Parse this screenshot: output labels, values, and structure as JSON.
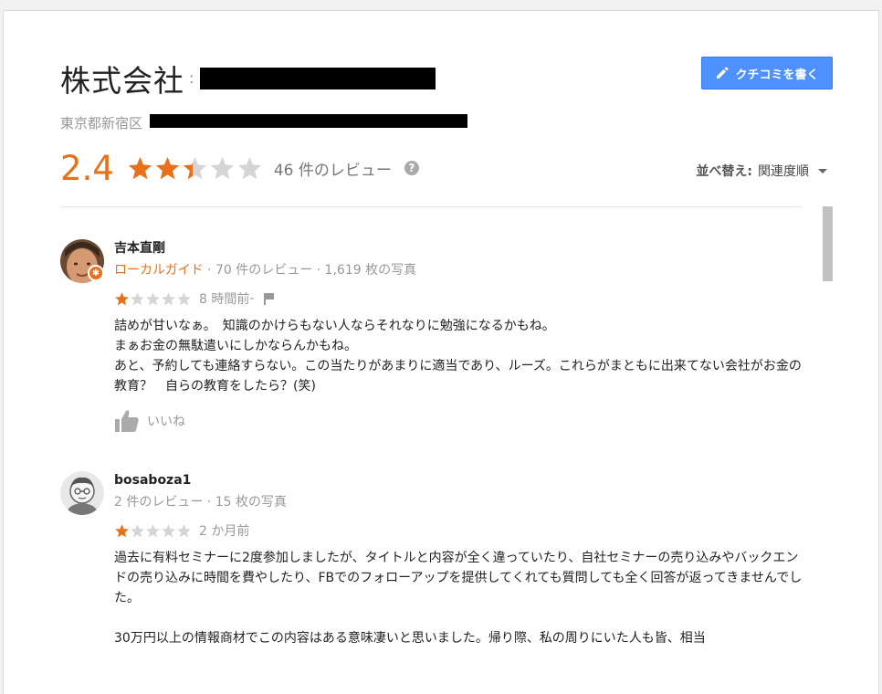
{
  "header": {
    "company_name": "株式会社",
    "colon": ":",
    "address_prefix": "東京都新宿区",
    "write_review_label": "クチコミを書く"
  },
  "summary": {
    "rating": "2.4",
    "rating_value": 2.4,
    "max_rating": 5,
    "review_count_label": "46 件のレビュー",
    "help_icon": "?"
  },
  "sort": {
    "label": "並べ替え:",
    "value": "関連度順"
  },
  "colors": {
    "accent_orange": "#e7711b",
    "star_empty": "#d5d5d5",
    "button_blue": "#4d90fe"
  },
  "reviews": [
    {
      "name": "吉本直剛",
      "is_local_guide": true,
      "local_guide_label": "ローカルガイド",
      "meta": " · 70 件のレビュー · 1,619 枚の写真",
      "stars": 1,
      "time": "8 時間前",
      "time_suffix": " - ",
      "text": "詰めが甘いなぁ。　知識のかけらもない人ならそれなりに勉強になるかもね。\nまぁお金の無駄遣いにしかならんかもね。\nあと、予約しても連絡すらない。この当たりがあまりに適当であり、ルーズ。これらがまともに出来てない会社がお金の教育？　自らの教育をしたら？(笑)",
      "like_label": "いいね"
    },
    {
      "name": "bosaboza1",
      "is_local_guide": false,
      "meta": "2 件のレビュー · 15 枚の写真",
      "stars": 1,
      "time": "2 か月前",
      "text": "過去に有料セミナーに2度参加しましたが、タイトルと内容が全く違っていたり、自社セミナーの売り込みやバックエンドの売り込みに時間を費やしたり、FBでのフォローアップを提供してくれても質問しても全く回答が返ってきませんでした。\n\n30万円以上の情報商材でこの内容はある意味凄いと思いました。帰り際、私の周りにいた人も皆、相当"
    }
  ]
}
